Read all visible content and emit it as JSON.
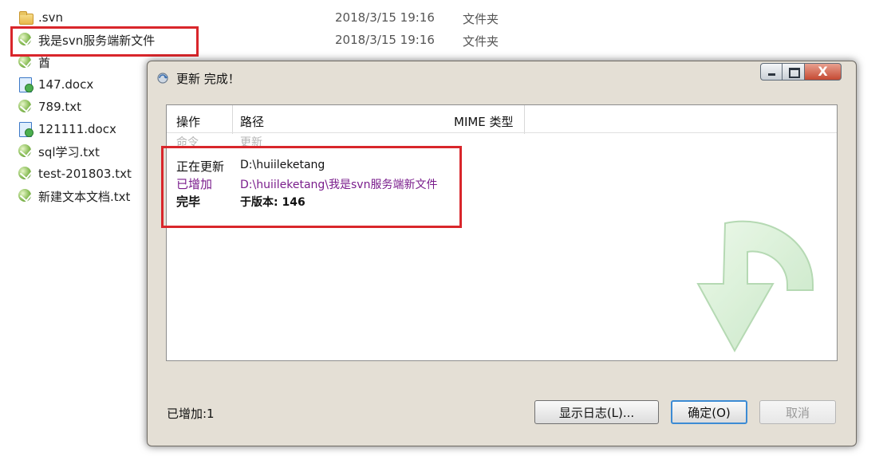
{
  "explorer": {
    "files": [
      {
        "name": ".svn",
        "date": "2018/3/15 19:16",
        "type": "文件夹",
        "icon": "folder-icon"
      },
      {
        "name": "我是svn服务端新文件",
        "date": "2018/3/15 19:16",
        "type": "文件夹",
        "icon": "svn-folder-icon"
      },
      {
        "name": "酋",
        "date": "",
        "type": "",
        "icon": "svn-folder-icon"
      },
      {
        "name": "147.docx",
        "date": "",
        "type": "",
        "icon": "doc-icon"
      },
      {
        "name": "789.txt",
        "date": "",
        "type": "",
        "icon": "svn-file-icon"
      },
      {
        "name": "121111.docx",
        "date": "",
        "type": "",
        "icon": "doc-icon"
      },
      {
        "name": "sql学习.txt",
        "date": "",
        "type": "",
        "icon": "svn-file-icon"
      },
      {
        "name": "test-201803.txt",
        "date": "",
        "type": "",
        "icon": "svn-file-icon"
      },
      {
        "name": "新建文本文档.txt",
        "date": "",
        "type": "",
        "icon": "svn-file-icon"
      }
    ]
  },
  "dialog": {
    "title": "更新 完成！",
    "close_glyph": "X",
    "columns": {
      "action": "操作",
      "path": "路径",
      "mime": "MIME 类型"
    },
    "ghost_row": {
      "action": "命令",
      "path": "更新"
    },
    "rows": [
      {
        "action": "正在更新",
        "path": "D:\\huiileketang"
      },
      {
        "action": "已增加",
        "path": "D:\\huiileketang\\我是svn服务端新文件"
      },
      {
        "action": "完毕",
        "path": "于版本: 146"
      }
    ],
    "status": "已增加:1",
    "buttons": {
      "show_log": "显示日志(L)...",
      "ok": "确定(O)",
      "cancel": "取消"
    }
  },
  "colors": {
    "highlight_box": "#d9262b",
    "added_text": "#7a1d8c",
    "arrow": "#bfe8bf"
  }
}
